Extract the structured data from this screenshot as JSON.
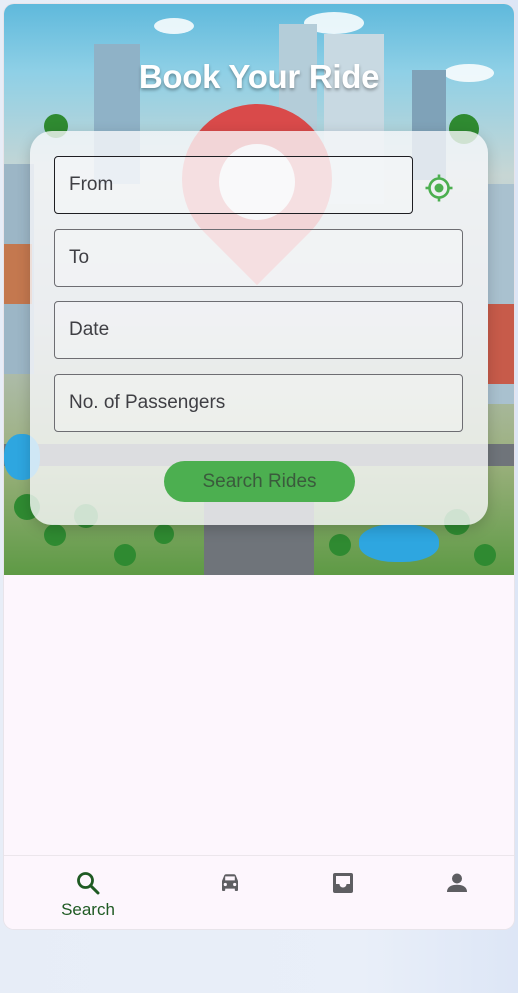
{
  "hero": {
    "title": "Book Your Ride"
  },
  "form": {
    "from_placeholder": "From",
    "to_placeholder": "To",
    "date_placeholder": "Date",
    "passengers_placeholder": "No. of Passengers",
    "search_button_label": "Search Rides"
  },
  "bottom_nav": {
    "items": [
      {
        "label": "Search",
        "icon": "search-icon",
        "active": true
      },
      {
        "label": "",
        "icon": "car-icon",
        "active": false
      },
      {
        "label": "",
        "icon": "inbox-icon",
        "active": false
      },
      {
        "label": "",
        "icon": "person-icon",
        "active": false
      }
    ]
  },
  "colors": {
    "accent": "#4caf50",
    "active_nav": "#1f5a23",
    "inactive_nav": "#5e5e62",
    "background": "#fdf6fd"
  }
}
